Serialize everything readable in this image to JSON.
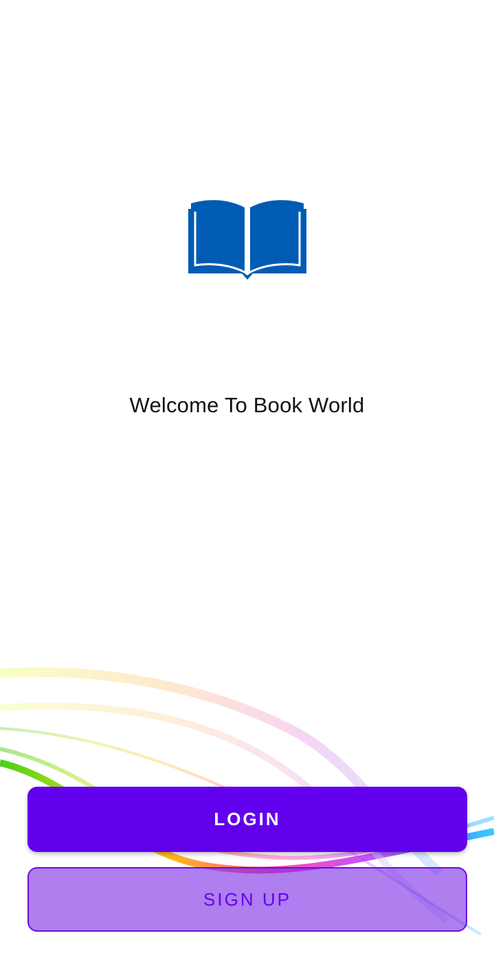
{
  "welcome_text": "Welcome To Book World",
  "logo_icon": "open-book-icon",
  "buttons": {
    "login_label": "LOGIN",
    "signup_label": "SIGN UP"
  },
  "colors": {
    "accent": "#6200ee",
    "logo_blue": "#005cb2",
    "signup_fill": "#b07ff0"
  }
}
